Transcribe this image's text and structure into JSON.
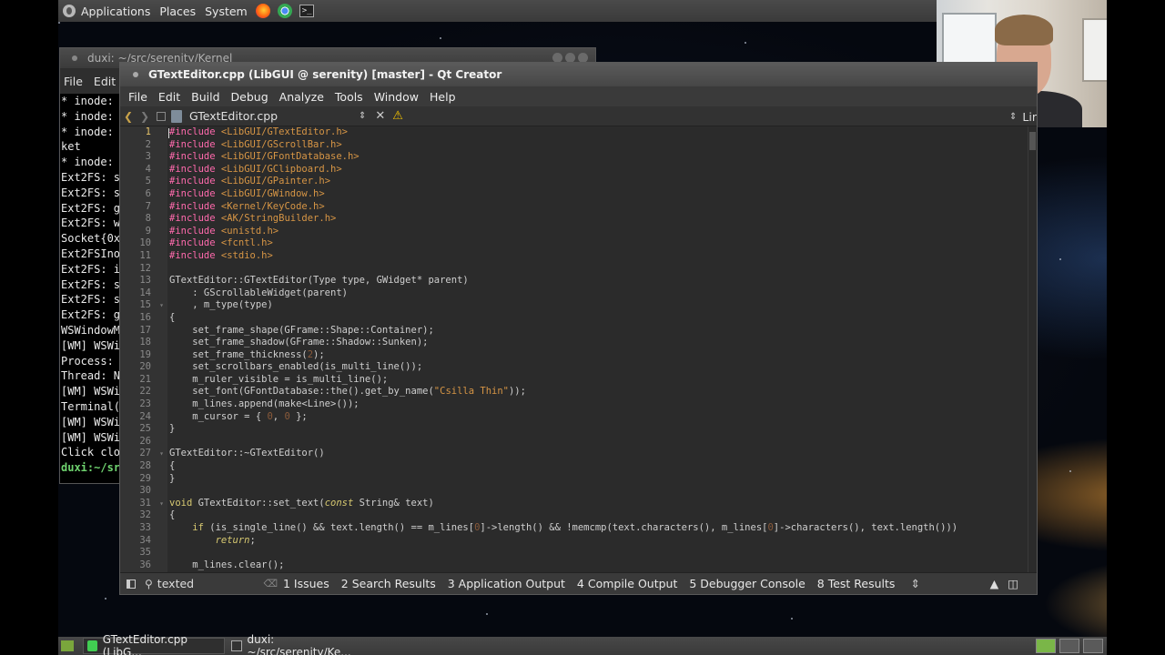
{
  "top_panel": {
    "applications": "Applications",
    "places": "Places",
    "system": "System"
  },
  "terminal": {
    "title": "duxi: ~/src/serenity/Kernel",
    "menu": [
      "File",
      "Edit"
    ],
    "lines": [
      "* inode:",
      "* inode:",
      "* inode:",
      "ket",
      "* inode:",
      "Ext2FS: s",
      "Ext2FS: s",
      "Ext2FS: g",
      "Ext2FS: w",
      "Socket{0x",
      "Ext2FSIno",
      "Ext2FS: i",
      "Ext2FS: s",
      "Ext2FS: s",
      "Ext2FS: g",
      "WSWindowM",
      "[WM] WSWi",
      "Process:",
      "Thread: N",
      "[WM] WSWi",
      "Terminal(",
      "[WM] WSWi",
      "[WM] WSWi",
      "Click clo"
    ],
    "prompt": "duxi:~/sr"
  },
  "qt": {
    "title": "GTextEditor.cpp (LibGUI @ serenity) [master] - Qt Creator",
    "menu": [
      "File",
      "Edit",
      "Build",
      "Debug",
      "Analyze",
      "Tools",
      "Window",
      "Help"
    ],
    "file_name": "GTextEditor.cpp",
    "right_combo": "Lir",
    "current_line": 1,
    "line_numbers": [
      "1",
      "2",
      "3",
      "4",
      "5",
      "6",
      "7",
      "8",
      "9",
      "10",
      "11",
      "12",
      "13",
      "14",
      "15",
      "16",
      "17",
      "18",
      "19",
      "20",
      "21",
      "22",
      "23",
      "24",
      "25",
      "26",
      "27",
      "28",
      "29",
      "30",
      "31",
      "32",
      "33",
      "34",
      "35",
      "36"
    ],
    "fold_lines": [
      15,
      27,
      31
    ],
    "code": [
      [
        [
          "pp",
          "#include "
        ],
        [
          "inc",
          "<LibGUI/GTextEditor.h>"
        ]
      ],
      [
        [
          "pp",
          "#include "
        ],
        [
          "inc",
          "<LibGUI/GScrollBar.h>"
        ]
      ],
      [
        [
          "pp",
          "#include "
        ],
        [
          "inc",
          "<LibGUI/GFontDatabase.h>"
        ]
      ],
      [
        [
          "pp",
          "#include "
        ],
        [
          "inc",
          "<LibGUI/GClipboard.h>"
        ]
      ],
      [
        [
          "pp",
          "#include "
        ],
        [
          "inc",
          "<LibGUI/GPainter.h>"
        ]
      ],
      [
        [
          "pp",
          "#include "
        ],
        [
          "inc",
          "<LibGUI/GWindow.h>"
        ]
      ],
      [
        [
          "pp",
          "#include "
        ],
        [
          "inc",
          "<Kernel/KeyCode.h>"
        ]
      ],
      [
        [
          "pp",
          "#include "
        ],
        [
          "inc",
          "<AK/StringBuilder.h>"
        ]
      ],
      [
        [
          "pp",
          "#include "
        ],
        [
          "inc",
          "<unistd.h>"
        ]
      ],
      [
        [
          "pp",
          "#include "
        ],
        [
          "inc",
          "<fcntl.h>"
        ]
      ],
      [
        [
          "pp",
          "#include "
        ],
        [
          "inc",
          "<stdio.h>"
        ]
      ],
      [],
      [
        [
          "",
          "GTextEditor::GTextEditor(Type type, GWidget* parent)"
        ]
      ],
      [
        [
          "",
          "    : GScrollableWidget(parent)"
        ]
      ],
      [
        [
          "",
          "    , m_type(type)"
        ]
      ],
      [
        [
          "",
          "{"
        ]
      ],
      [
        [
          "",
          "    set_frame_shape(GFrame::Shape::Container);"
        ]
      ],
      [
        [
          "",
          "    set_frame_shadow(GFrame::Shadow::Sunken);"
        ]
      ],
      [
        [
          "",
          "    set_frame_thickness("
        ],
        [
          "num",
          "2"
        ],
        [
          "",
          ");"
        ]
      ],
      [
        [
          "",
          "    set_scrollbars_enabled(is_multi_line());"
        ]
      ],
      [
        [
          "",
          "    m_ruler_visible = is_multi_line();"
        ]
      ],
      [
        [
          "",
          "    set_font(GFontDatabase::the().get_by_name("
        ],
        [
          "str",
          "\"Csilla Thin\""
        ],
        [
          "",
          "));"
        ]
      ],
      [
        [
          "",
          "    m_lines.append(make<Line>());"
        ]
      ],
      [
        [
          "",
          "    m_cursor = { "
        ],
        [
          "num",
          "0"
        ],
        [
          "",
          ", "
        ],
        [
          "num",
          "0"
        ],
        [
          "",
          " };"
        ]
      ],
      [
        [
          "",
          "}"
        ]
      ],
      [],
      [
        [
          "",
          "GTextEditor::~GTextEditor()"
        ]
      ],
      [
        [
          "",
          "{"
        ]
      ],
      [
        [
          "",
          "}"
        ]
      ],
      [],
      [
        [
          "kw",
          "void "
        ],
        [
          "",
          "GTextEditor::set_text("
        ],
        [
          "it",
          "const "
        ],
        [
          "",
          "String& text)"
        ]
      ],
      [
        [
          "",
          "{"
        ]
      ],
      [
        [
          "",
          "    "
        ],
        [
          "kw",
          "if "
        ],
        [
          "",
          "(is_single_line() && text.length() == m_lines["
        ],
        [
          "num",
          "0"
        ],
        [
          "",
          "]->length() && !memcmp(text.characters(), m_lines["
        ],
        [
          "num",
          "0"
        ],
        [
          "",
          "]->characters(), text.length()))"
        ]
      ],
      [
        [
          "",
          "        "
        ],
        [
          "it",
          "return"
        ],
        [
          "",
          ";"
        ]
      ],
      [],
      [
        [
          "",
          "    m_lines.clear();"
        ]
      ]
    ],
    "status": {
      "locator": "texted",
      "panes": [
        "1  Issues",
        "2  Search Results",
        "3  Application Output",
        "4  Compile Output",
        "5  Debugger Console",
        "8  Test Results"
      ]
    }
  },
  "taskbar": {
    "tasks": [
      "GTextEditor.cpp (LibG...",
      "duxi: ~/src/serenity/Ke..."
    ]
  }
}
